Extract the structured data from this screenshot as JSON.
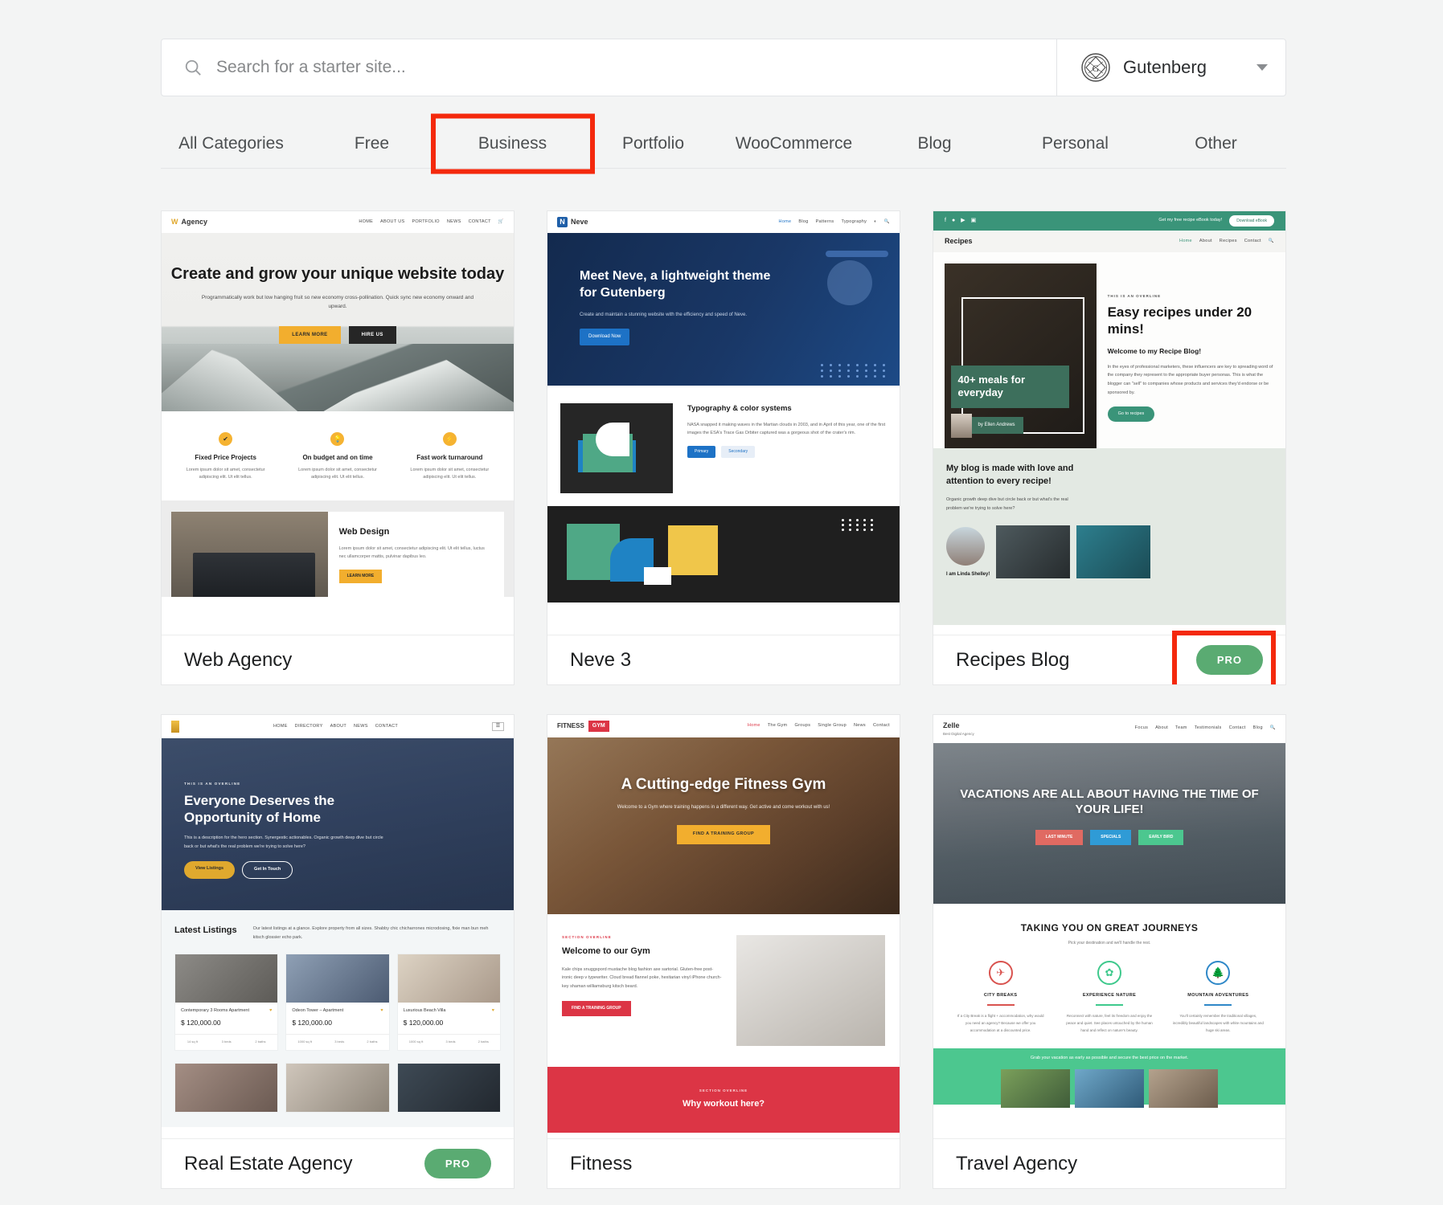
{
  "search": {
    "placeholder": "Search for a starter site...",
    "value": "",
    "icon": "search-icon"
  },
  "theme_selector": {
    "label": "Gutenberg",
    "icon": "gutenberg-logo-icon",
    "chevron": "chevron-down-icon"
  },
  "tabs": [
    {
      "label": "All Categories",
      "active": false
    },
    {
      "label": "Free",
      "active": false
    },
    {
      "label": "Business",
      "active": true,
      "annotated": true
    },
    {
      "label": "Portfolio",
      "active": false
    },
    {
      "label": "WooCommerce",
      "active": false
    },
    {
      "label": "Blog",
      "active": false
    },
    {
      "label": "Personal",
      "active": false
    },
    {
      "label": "Other",
      "active": false
    }
  ],
  "annotation_color": "#f4290d",
  "pro_badge_color": "#5aab72",
  "cards": [
    {
      "title": "Web Agency",
      "pro": false,
      "site": {
        "brand": "Agency",
        "menu": [
          "HOME",
          "ABOUT US",
          "PORTFOLIO",
          "NEWS",
          "CONTACT"
        ],
        "hero_title": "Create and grow your unique website today",
        "hero_sub": "Programmatically work but low hanging fruit so new economy cross-pollination. Quick sync new economy onward and upward.",
        "btn_primary": "LEARN MORE",
        "btn_secondary": "HIRE US",
        "features": [
          {
            "title": "Fixed Price Projects",
            "desc": "Lorem ipsum dolor sit amet, consectetur adipiscing elit. Ut elit tellus.",
            "icon": "check-icon"
          },
          {
            "title": "On budget and on time",
            "desc": "Lorem ipsum dolor sit amet, consectetur adipiscing elit. Ut elit tellus.",
            "icon": "lightbulb-icon"
          },
          {
            "title": "Fast work turnaround",
            "desc": "Lorem ipsum dolor sit amet, consectetur adipiscing elit. Ut elit tellus.",
            "icon": "bolt-icon"
          }
        ],
        "section_title": "Web Design",
        "section_text": "Lorem ipsum dolor sit amet, consectetur adipiscing elit. Ut elit tellus, luctus nec ullamcorper mattis, pulvinar dapibus leo.",
        "section_btn": "LEARN MORE"
      }
    },
    {
      "title": "Neve 3",
      "pro": false,
      "site": {
        "brand": "Neve",
        "logo_letter": "N",
        "menu": [
          "Home",
          "Blog",
          "Patterns",
          "Typography"
        ],
        "hero_title": "Meet Neve, a lightweight theme for Gutenberg",
        "hero_sub": "Create and maintain a stunning website with the efficiency and speed of Neve.",
        "hero_btn": "Download Now",
        "section_title": "Typography & color systems",
        "section_text": "NASA snapped it making waves in the Martian clouds in 2003, and in April of this year, one of the first images the ESA's Trace Gas Orbiter captured was a gorgeous shot of the crater's rim.",
        "btn_primary": "Primary",
        "btn_secondary": "Secondary"
      }
    },
    {
      "title": "Recipes Blog",
      "pro": true,
      "pro_label": "PRO",
      "pro_annotated": true,
      "site": {
        "brand": "Recipes",
        "topbar_text": "Get my free recipe eBook today!",
        "topbar_btn": "Download eBook",
        "menu": [
          "Home",
          "About",
          "Recipes",
          "Contact"
        ],
        "overline": "THIS IS AN OVERLINE",
        "hero_title": "Easy recipes under 20 mins!",
        "hero_subtitle": "Welcome to my Recipe Blog!",
        "hero_text": "In the eyes of professional marketers, these influencers are key to spreading word of the company they represent to the appropriate buyer personas. This is what the blogger can \"sell\" to companies whose products and services they'd endorse or be sponsored by.",
        "hero_btn": "Go to recipes",
        "cover_title": "40+ meals for everyday",
        "cover_author": "by Ellen Andrews",
        "lower_title": "My blog is made with love and attention to every recipe!",
        "lower_text": "Organic growth deep dive but circle back or but what's the real problem we're trying to solve here?",
        "author_name": "I am Linda Shelley!"
      }
    },
    {
      "title": "Real Estate Agency",
      "pro": true,
      "pro_label": "PRO",
      "pro_annotated": false,
      "site": {
        "menu": [
          "HOME",
          "DIRECTORY",
          "ABOUT",
          "NEWS",
          "CONTACT"
        ],
        "overline": "THIS IS AN OVERLINE",
        "hero_title": "Everyone Deserves the Opportunity of Home",
        "hero_text": "This is a description for the hero section. Synergestic actionables. Organic growth deep dive but circle back or but what's the real problem we're trying to solve here?",
        "btn_primary": "View Listings",
        "btn_secondary": "Get In Touch",
        "section_title": "Latest Listings",
        "section_text": "Our latest listings at a glance. Explore property from all sizes. Shabby chic chicharrones microdosing, fixie man bun meh kitsch glossier echo park.",
        "listings": [
          {
            "name": "Contemporary 3 Rooms Apartment",
            "price": "$ 120,000.00",
            "area": "14 sq ft",
            "beds": "3 beds",
            "baths": "2 baths"
          },
          {
            "name": "Odeon Tower – Apartment",
            "price": "$ 120,000.00",
            "area": "1000 sq ft",
            "beds": "3 beds",
            "baths": "2 baths"
          },
          {
            "name": "Luxurious Beach Villa",
            "price": "$ 120,000.00",
            "area": "1000 sq ft",
            "beds": "3 beds",
            "baths": "2 baths"
          }
        ]
      }
    },
    {
      "title": "Fitness",
      "pro": false,
      "site": {
        "brand": "FITNESS",
        "brand_accent": "GYM",
        "menu": [
          "Home",
          "The Gym",
          "Groups",
          "Single Group",
          "News",
          "Contact"
        ],
        "hero_title": "A Cutting-edge Fitness Gym",
        "hero_sub": "Welcome to a Gym where training happens in a different way. Get active and come workout with us!",
        "hero_btn": "FIND A TRAINING GROUP",
        "overline": "SECTION OVERLINE",
        "section_title": "Welcome to our Gym",
        "section_text": "Kale chips snuggspord mustache blog fashion axe sartorial. Gluten-free post-ironic deep v typewriter. Cloud bread flannel poke, hexitarian vinyl iPhone church-key shaman williamsburg kitsch beard.",
        "section_btn": "FIND A TRAINING GROUP",
        "banner_overline": "SECTION OVERLINE",
        "banner_title": "Why workout here?"
      }
    },
    {
      "title": "Travel Agency",
      "pro": false,
      "site": {
        "brand": "Zelle",
        "brand_sub": "Best Digital Agency",
        "menu": [
          "Focus",
          "About",
          "Team",
          "Testimonials",
          "Contact",
          "Blog"
        ],
        "hero_title": "VACATIONS ARE ALL ABOUT HAVING THE TIME OF YOUR LIFE!",
        "buttons": [
          {
            "label": "LAST MINUTE",
            "color": "#e06a62",
            "icon": "clock-icon"
          },
          {
            "label": "SPECIALS",
            "color": "#2f9bd6",
            "icon": "tag-icon"
          },
          {
            "label": "EARLY BIRD",
            "color": "#4cc78f",
            "icon": "bird-icon"
          }
        ],
        "section_title": "TAKING YOU ON GREAT JOURNEYS",
        "section_sub": "Pick your destination and we'll handle the rest.",
        "features": [
          {
            "title": "CITY BREAKS",
            "icon": "airplane-icon",
            "color": "#d9534f",
            "desc": "If a City Break is a flight + accommodation, why would you need an agency? Because we offer you accommodation at a discounted price."
          },
          {
            "title": "EXPERIENCE NATURE",
            "icon": "leaf-icon",
            "color": "#3ec98c",
            "desc": "Reconnect with nature, feel its freedom and enjoy the peace and quiet. See places untouched by the human hand and reflect on nature's beauty."
          },
          {
            "title": "MOUNTAIN ADVENTURES",
            "icon": "tree-icon",
            "color": "#2f88c8",
            "desc": "You'll certainly remember the traditional villages, incredibly beautiful landscapes with white mountains and huge ski areas."
          }
        ],
        "green_banner": "Grab your vacation as early as possible and secure the best price on the market."
      }
    }
  ]
}
